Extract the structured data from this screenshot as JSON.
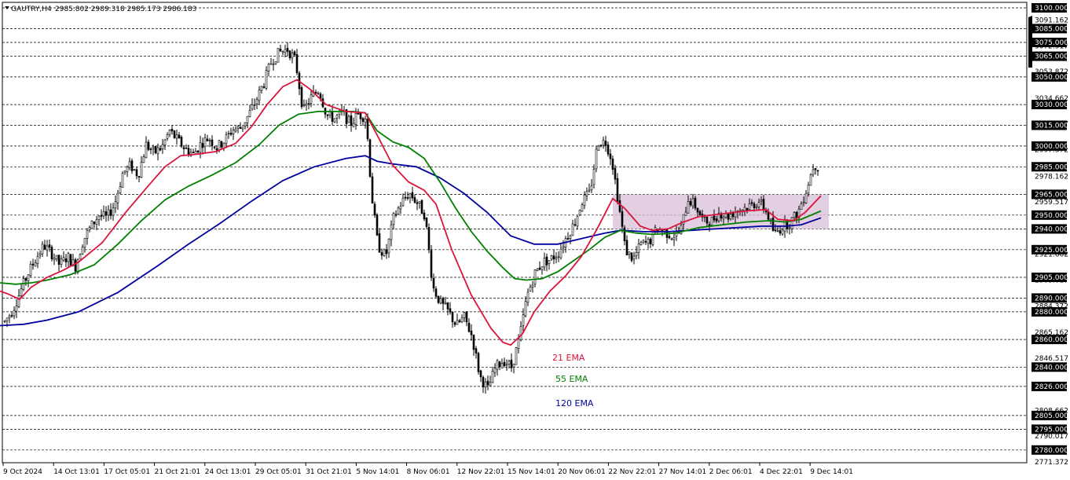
{
  "header": {
    "symbol": "GAUTRY,H4",
    "ohlc": "2985.802 2989.318 2985.173 2986.183"
  },
  "colors": {
    "background": "#ffffff",
    "candle": "#000000",
    "grid": "#000000",
    "ema21": "#dc143c",
    "ema55": "#008000",
    "ema120": "#0000a0",
    "zone": "#d8bfd8",
    "label_bg": "#000000",
    "label_text": "#ffffff"
  },
  "chart_data": {
    "type": "candlestick",
    "title": "",
    "ylim": [
      2771.372,
      3100
    ],
    "grid": "dashed horizontal",
    "x_ticks": [
      "9 Oct 2024",
      "14 Oct 13:01",
      "17 Oct 05:01",
      "21 Oct 21:01",
      "24 Oct 13:01",
      "29 Oct 05:01",
      "31 Oct 21:01",
      "5 Nov 14:01",
      "8 Nov 06:01",
      "12 Nov 22:01",
      "15 Nov 14:01",
      "20 Nov 06:01",
      "22 Nov 22:01",
      "27 Nov 14:01",
      "2 Dec 06:01",
      "4 Dec 22:01",
      "9 Dec 14:01"
    ],
    "y_labels_highlighted": [
      3100,
      3085,
      3075,
      3065,
      3050,
      3030,
      3015,
      3000,
      2985,
      2965,
      2950,
      2940,
      2925,
      2905,
      2890,
      2880,
      2860,
      2840,
      2826,
      2805,
      2795,
      2780
    ],
    "y_labels_plain": [
      3091.162,
      3072.517,
      3053.872,
      3034.662,
      3016.017,
      2997.372,
      2978.162,
      2959.517,
      2921.662,
      2903.017,
      2884.372,
      2865.162,
      2846.517,
      2808.662,
      2790.017,
      2771.372
    ],
    "ema_labels": [
      "21 EMA",
      "55 EMA",
      "120 EMA"
    ],
    "ema21": [
      [
        0,
        2895
      ],
      [
        10,
        2893
      ],
      [
        25,
        2889
      ],
      [
        40,
        2898
      ],
      [
        60,
        2905
      ],
      [
        80,
        2910
      ],
      [
        100,
        2916
      ],
      [
        130,
        2930
      ],
      [
        160,
        2952
      ],
      [
        190,
        2972
      ],
      [
        210,
        2985
      ],
      [
        230,
        2993
      ],
      [
        250,
        2994
      ],
      [
        275,
        2996
      ],
      [
        300,
        3002
      ],
      [
        320,
        3014
      ],
      [
        340,
        3030
      ],
      [
        360,
        3043
      ],
      [
        378,
        3048
      ],
      [
        395,
        3041
      ],
      [
        415,
        3030
      ],
      [
        440,
        3025
      ],
      [
        465,
        3024
      ],
      [
        480,
        3008
      ],
      [
        500,
        2986
      ],
      [
        520,
        2974
      ],
      [
        540,
        2968
      ],
      [
        555,
        2958
      ],
      [
        575,
        2925
      ],
      [
        600,
        2892
      ],
      [
        625,
        2868
      ],
      [
        640,
        2858
      ],
      [
        650,
        2856
      ],
      [
        665,
        2864
      ],
      [
        680,
        2880
      ],
      [
        700,
        2895
      ],
      [
        720,
        2906
      ],
      [
        740,
        2920
      ],
      [
        760,
        2940
      ],
      [
        780,
        2962
      ],
      [
        795,
        2955
      ],
      [
        815,
        2942
      ],
      [
        830,
        2939
      ],
      [
        850,
        2940
      ],
      [
        870,
        2945
      ],
      [
        890,
        2949
      ],
      [
        920,
        2951
      ],
      [
        950,
        2953
      ],
      [
        975,
        2954
      ],
      [
        990,
        2947
      ],
      [
        1010,
        2946
      ],
      [
        1025,
        2952
      ],
      [
        1045,
        2964
      ]
    ],
    "ema55": [
      [
        0,
        2901
      ],
      [
        20,
        2900
      ],
      [
        40,
        2901
      ],
      [
        60,
        2903
      ],
      [
        90,
        2907
      ],
      [
        120,
        2914
      ],
      [
        150,
        2929
      ],
      [
        180,
        2946
      ],
      [
        210,
        2961
      ],
      [
        240,
        2971
      ],
      [
        270,
        2979
      ],
      [
        300,
        2988
      ],
      [
        330,
        3001
      ],
      [
        355,
        3015
      ],
      [
        380,
        3023
      ],
      [
        405,
        3025
      ],
      [
        430,
        3025
      ],
      [
        450,
        3025
      ],
      [
        465,
        3024
      ],
      [
        480,
        3011
      ],
      [
        500,
        3003
      ],
      [
        520,
        2999
      ],
      [
        540,
        2991
      ],
      [
        560,
        2974
      ],
      [
        580,
        2955
      ],
      [
        600,
        2938
      ],
      [
        620,
        2924
      ],
      [
        640,
        2912
      ],
      [
        655,
        2904
      ],
      [
        670,
        2903
      ],
      [
        690,
        2904
      ],
      [
        710,
        2909
      ],
      [
        730,
        2917
      ],
      [
        750,
        2925
      ],
      [
        770,
        2934
      ],
      [
        790,
        2939
      ],
      [
        810,
        2937
      ],
      [
        830,
        2936
      ],
      [
        860,
        2937
      ],
      [
        890,
        2941
      ],
      [
        920,
        2943
      ],
      [
        950,
        2945
      ],
      [
        980,
        2946
      ],
      [
        1000,
        2945
      ],
      [
        1020,
        2947
      ],
      [
        1045,
        2953
      ]
    ],
    "ema120": [
      [
        0,
        2870
      ],
      [
        30,
        2871
      ],
      [
        60,
        2874
      ],
      [
        100,
        2880
      ],
      [
        150,
        2894
      ],
      [
        200,
        2913
      ],
      [
        240,
        2929
      ],
      [
        280,
        2944
      ],
      [
        320,
        2960
      ],
      [
        360,
        2975
      ],
      [
        400,
        2985
      ],
      [
        440,
        2991
      ],
      [
        465,
        2993
      ],
      [
        480,
        2989
      ],
      [
        500,
        2987
      ],
      [
        530,
        2985
      ],
      [
        560,
        2977
      ],
      [
        590,
        2966
      ],
      [
        620,
        2952
      ],
      [
        650,
        2935
      ],
      [
        680,
        2929
      ],
      [
        710,
        2929
      ],
      [
        740,
        2933
      ],
      [
        770,
        2937
      ],
      [
        790,
        2939
      ],
      [
        820,
        2938
      ],
      [
        850,
        2938
      ],
      [
        880,
        2939
      ],
      [
        910,
        2940
      ],
      [
        940,
        2941
      ],
      [
        970,
        2942
      ],
      [
        1000,
        2942
      ],
      [
        1020,
        2943
      ],
      [
        1045,
        2948
      ]
    ],
    "price_path": [
      [
        5,
        2873
      ],
      [
        15,
        2881
      ],
      [
        25,
        2895
      ],
      [
        35,
        2908
      ],
      [
        45,
        2919
      ],
      [
        55,
        2928
      ],
      [
        65,
        2922
      ],
      [
        75,
        2914
      ],
      [
        85,
        2920
      ],
      [
        95,
        2913
      ],
      [
        105,
        2932
      ],
      [
        115,
        2942
      ],
      [
        125,
        2950
      ],
      [
        135,
        2948
      ],
      [
        145,
        2958
      ],
      [
        155,
        2980
      ],
      [
        165,
        2986
      ],
      [
        175,
        2979
      ],
      [
        185,
        3001
      ],
      [
        195,
        2995
      ],
      [
        205,
        2999
      ],
      [
        215,
        3011
      ],
      [
        225,
        3004
      ],
      [
        235,
        2998
      ],
      [
        245,
        2994
      ],
      [
        255,
        3002
      ],
      [
        265,
        3006
      ],
      [
        275,
        2999
      ],
      [
        285,
        3004
      ],
      [
        295,
        3012
      ],
      [
        305,
        3013
      ],
      [
        315,
        3022
      ],
      [
        325,
        3033
      ],
      [
        335,
        3046
      ],
      [
        345,
        3062
      ],
      [
        355,
        3068
      ],
      [
        365,
        3070
      ],
      [
        375,
        3062
      ],
      [
        385,
        3025
      ],
      [
        395,
        3035
      ],
      [
        405,
        3041
      ],
      [
        415,
        3022
      ],
      [
        425,
        3020
      ],
      [
        435,
        3024
      ],
      [
        445,
        3016
      ],
      [
        455,
        3023
      ],
      [
        465,
        3021
      ],
      [
        472,
        2965
      ],
      [
        480,
        2928
      ],
      [
        490,
        2920
      ],
      [
        500,
        2948
      ],
      [
        510,
        2959
      ],
      [
        520,
        2966
      ],
      [
        530,
        2959
      ],
      [
        540,
        2950
      ],
      [
        550,
        2898
      ],
      [
        560,
        2886
      ],
      [
        570,
        2880
      ],
      [
        580,
        2870
      ],
      [
        590,
        2876
      ],
      [
        600,
        2862
      ],
      [
        610,
        2833
      ],
      [
        620,
        2824
      ],
      [
        630,
        2840
      ],
      [
        640,
        2845
      ],
      [
        650,
        2840
      ],
      [
        660,
        2860
      ],
      [
        670,
        2892
      ],
      [
        680,
        2908
      ],
      [
        690,
        2916
      ],
      [
        700,
        2918
      ],
      [
        710,
        2923
      ],
      [
        720,
        2934
      ],
      [
        730,
        2944
      ],
      [
        740,
        2960
      ],
      [
        750,
        2966
      ],
      [
        760,
        3003
      ],
      [
        770,
        3003
      ],
      [
        778,
        2990
      ],
      [
        786,
        2960
      ],
      [
        795,
        2925
      ],
      [
        805,
        2918
      ],
      [
        815,
        2929
      ],
      [
        825,
        2930
      ],
      [
        835,
        2940
      ],
      [
        845,
        2938
      ],
      [
        855,
        2935
      ],
      [
        865,
        2938
      ],
      [
        875,
        2962
      ],
      [
        885,
        2956
      ],
      [
        895,
        2945
      ],
      [
        905,
        2946
      ],
      [
        915,
        2952
      ],
      [
        925,
        2949
      ],
      [
        935,
        2953
      ],
      [
        945,
        2955
      ],
      [
        955,
        2957
      ],
      [
        965,
        2960
      ],
      [
        975,
        2952
      ],
      [
        985,
        2936
      ],
      [
        995,
        2942
      ],
      [
        1005,
        2945
      ],
      [
        1015,
        2952
      ],
      [
        1025,
        2968
      ],
      [
        1035,
        2987
      ],
      [
        1042,
        2985
      ]
    ],
    "zone": {
      "x_start": 780,
      "x_end": 1055,
      "y_low": 2940,
      "y_high": 2965
    }
  }
}
